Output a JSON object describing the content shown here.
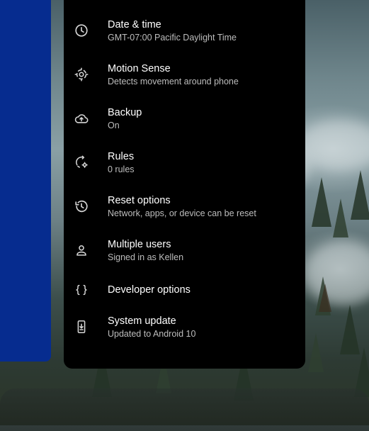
{
  "settings": {
    "items": [
      {
        "icon": "clock-icon",
        "title": "Date & time",
        "subtitle": "GMT-07:00 Pacific Daylight Time"
      },
      {
        "icon": "motion-sense-icon",
        "title": "Motion Sense",
        "subtitle": "Detects movement around phone"
      },
      {
        "icon": "cloud-upload-icon",
        "title": "Backup",
        "subtitle": "On"
      },
      {
        "icon": "rules-icon",
        "title": "Rules",
        "subtitle": "0 rules"
      },
      {
        "icon": "history-icon",
        "title": "Reset options",
        "subtitle": "Network, apps, or device can be reset"
      },
      {
        "icon": "person-icon",
        "title": "Multiple users",
        "subtitle": "Signed in as Kellen"
      },
      {
        "icon": "braces-icon",
        "title": "Developer options",
        "subtitle": ""
      },
      {
        "icon": "system-update-icon",
        "title": "System update",
        "subtitle": "Updated to Android 10"
      }
    ]
  },
  "colors": {
    "panel_background": "#000000",
    "side_card": "#062c8f",
    "title_text": "#ffffff",
    "subtitle_text": "#bdbdbd"
  }
}
